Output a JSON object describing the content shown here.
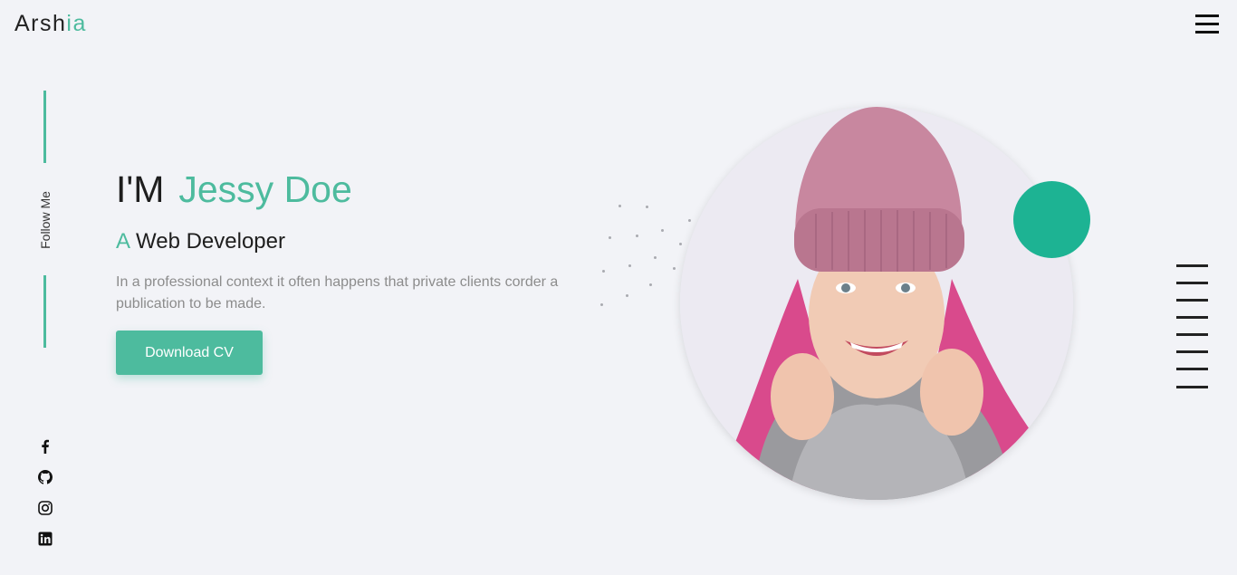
{
  "header": {
    "logo_main": "Arsh",
    "logo_accent": "ia",
    "menu_icon": "hamburger-menu-icon"
  },
  "sidebar": {
    "follow_label": "Follow Me",
    "socials": [
      {
        "icon": "facebook-icon",
        "label": "Facebook"
      },
      {
        "icon": "github-icon",
        "label": "GitHub"
      },
      {
        "icon": "instagram-icon",
        "label": "Instagram"
      },
      {
        "icon": "linkedin-icon",
        "label": "LinkedIn"
      }
    ]
  },
  "hero": {
    "intro": "I'M",
    "name": "Jessy Doe",
    "role_prefix": "A",
    "role": "Web Developer",
    "description": "In a professional context it often happens that private clients corder a publication to be made.",
    "cta_label": "Download CV",
    "image": "portrait-photo"
  },
  "colors": {
    "accent": "#4dbb9e",
    "accent_dark": "#1db393",
    "background": "#f2f3f7",
    "text": "#1e1e1e"
  }
}
